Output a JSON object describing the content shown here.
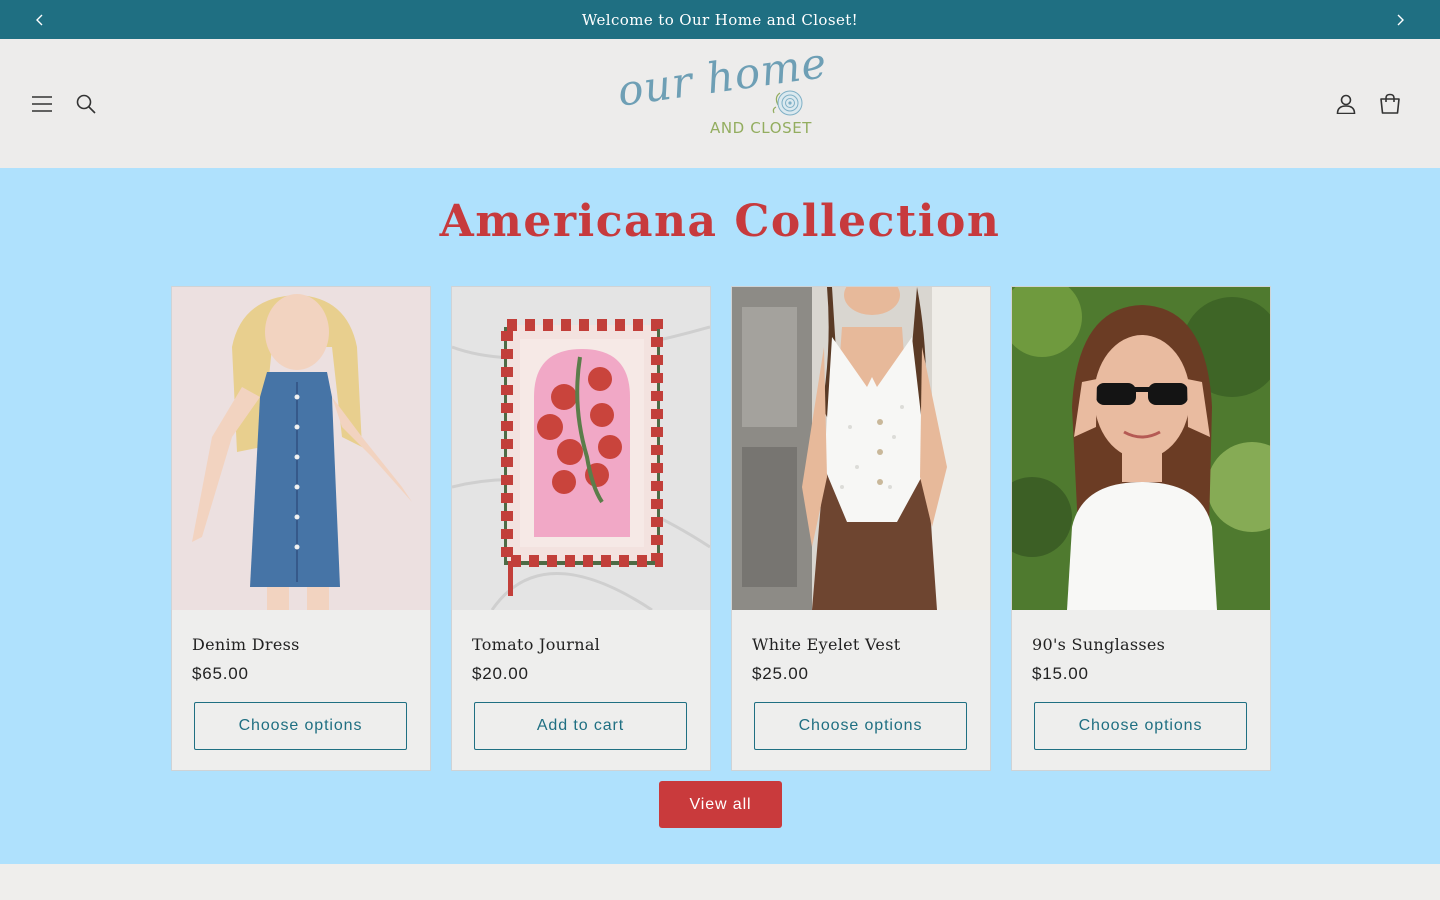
{
  "announcement": {
    "text": "Welcome to Our Home and Closet!",
    "prev_icon": "chevron-left-icon",
    "next_icon": "chevron-right-icon",
    "background": "#1f6f82"
  },
  "header": {
    "menu_icon": "hamburger-menu-icon",
    "search_icon": "search-icon",
    "account_icon": "account-icon",
    "cart_icon": "cart-icon",
    "logo": {
      "script": "our home",
      "subtitle": "AND CLOSET"
    }
  },
  "collection": {
    "title": "Americana Collection",
    "background": "#afe1fd",
    "title_color": "#c73a3d",
    "products": [
      {
        "name": "Denim Dress",
        "price": "$65.00",
        "button": "Choose options"
      },
      {
        "name": "Tomato Journal",
        "price": "$20.00",
        "button": "Add to cart"
      },
      {
        "name": "White Eyelet Vest",
        "price": "$25.00",
        "button": "Choose options"
      },
      {
        "name": "90's Sunglasses",
        "price": "$15.00",
        "button": "Choose options"
      }
    ],
    "view_all": "View all"
  },
  "colors": {
    "accent": "#1f6f82",
    "button_primary": "#c93a3c",
    "page_bg": "#efeeec"
  }
}
